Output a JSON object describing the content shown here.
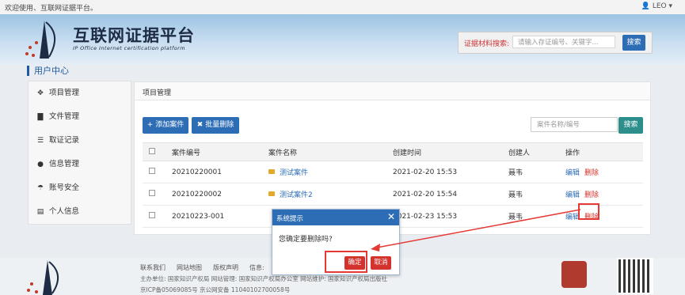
{
  "topbar": {
    "welcome": "欢迎使用、互联网证据平台。",
    "user": "LEO"
  },
  "brand": {
    "title": "互联网证据平台",
    "subtitle": "IP Office Internet certification platform"
  },
  "search": {
    "label": "证据材料搜索:",
    "placeholder": "请输入存证编号、关键字...",
    "button": "搜索"
  },
  "user_center": "用户中心",
  "sidebar": {
    "items": [
      {
        "label": "项目管理",
        "icon": "cubes-icon"
      },
      {
        "label": "文件管理",
        "icon": "file-icon"
      },
      {
        "label": "取证记录",
        "icon": "database-icon"
      },
      {
        "label": "信息管理",
        "icon": "comment-icon"
      },
      {
        "label": "账号安全",
        "icon": "umbrella-icon"
      },
      {
        "label": "个人信息",
        "icon": "id-card-icon"
      }
    ]
  },
  "main": {
    "title": "项目管理",
    "add_button": "+ 添加案件",
    "batch_delete_button": "✖ 批量删除",
    "table_search_placeholder": "案件名称/编号",
    "table_search_button": "搜索",
    "columns": [
      "案件编号",
      "案件名称",
      "创建时间",
      "创建人",
      "操作"
    ],
    "rows": [
      {
        "id": "20210220001",
        "name": "测试案件",
        "created": "2021-02-20 15:53",
        "creator": "聂韦",
        "edit": "编辑",
        "delete": "删除"
      },
      {
        "id": "20210220002",
        "name": "测试案件2",
        "created": "2021-02-20 15:54",
        "creator": "聂韦",
        "edit": "编辑",
        "delete": "删除"
      },
      {
        "id": "20210223-001",
        "name": "",
        "created": "2021-02-23 15:53",
        "creator": "聂韦",
        "edit": "编辑",
        "delete": "删除"
      }
    ]
  },
  "modal": {
    "title": "系统提示",
    "message": "您确定要删除吗?",
    "ok": "确定",
    "cancel": "取消"
  },
  "footer": {
    "links": [
      "联系我们",
      "网站地图",
      "版权声明",
      "信息:"
    ],
    "line2": "主办单位: 国家知识产权局        网站管理: 国家知识产权局办公室        网站维护: 国家知识产权局出版社",
    "line3": "京ICP备05069085号        京公网安备 11040102700058号"
  },
  "colors": {
    "accent": "#2d6db5",
    "danger": "#d4322c",
    "highlight": "#e53935"
  }
}
